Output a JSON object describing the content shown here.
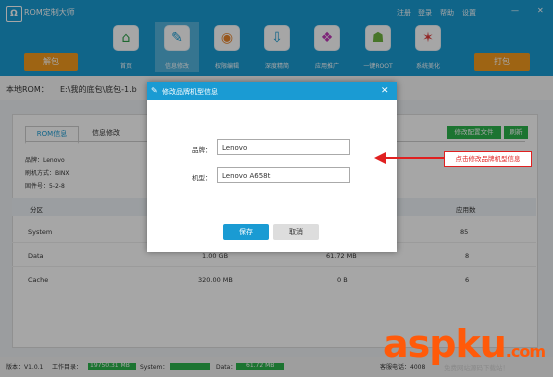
{
  "app": {
    "logo_letter": "Ω",
    "title": "ROM定制大师"
  },
  "titlebar": {
    "links": [
      "注册",
      "登录",
      "帮助",
      "设置"
    ],
    "minimize": "—",
    "close": "✕"
  },
  "toolbar": {
    "unpack_label": "解包",
    "pack_label": "打包",
    "nav": [
      {
        "label": "首页",
        "icon": "home-icon",
        "glyph": "⌂",
        "color": "#2ea04a"
      },
      {
        "label": "信息修改",
        "icon": "edit-icon",
        "glyph": "✎",
        "color": "#1a9bd3"
      },
      {
        "label": "权限编辑",
        "icon": "location-icon",
        "glyph": "◉",
        "color": "#e8842b"
      },
      {
        "label": "深度精简",
        "icon": "download-icon",
        "glyph": "⇩",
        "color": "#1a9bd3"
      },
      {
        "label": "应用推广",
        "icon": "apps-icon",
        "glyph": "❖",
        "color": "#c03ab9"
      },
      {
        "label": "一键ROOT",
        "icon": "android-icon",
        "glyph": "☗",
        "color": "#6fb43f"
      },
      {
        "label": "系统美化",
        "icon": "magic-wand-icon",
        "glyph": "✶",
        "color": "#e03a3a"
      }
    ]
  },
  "path": {
    "label": "本地ROM：",
    "value": "E:\\我的底包\\底包-1.b"
  },
  "tabs": [
    "ROM信息",
    "信息修改"
  ],
  "actions": {
    "modify_config": "修改配置文件",
    "refresh": "刷新"
  },
  "info": {
    "brand": "品牌：Lenovo",
    "flash_method": "刷机方式：BINX",
    "firmware": "固件号：5-2-8"
  },
  "table": {
    "headers": [
      "分区",
      "",
      "",
      "",
      "应用数"
    ],
    "rows": [
      [
        "System",
        "",
        "",
        "",
        "85"
      ],
      [
        "Data",
        "1.00 GB",
        "",
        "61.72 MB",
        "8"
      ],
      [
        "Cache",
        "320.00 MB",
        "",
        "0 B",
        "6"
      ]
    ]
  },
  "status": {
    "version": "版本：V1.0.1",
    "workdir_label": "工作目录：",
    "workdir_value": "19750.31 MB",
    "system_label": "System：",
    "data_label": "Data：",
    "data_value": "61.72 MB",
    "service": "客服电话：4008"
  },
  "dialog": {
    "title": "修改品牌机型信息",
    "close": "✕",
    "brand_label": "品牌：",
    "brand_value": "Lenovo",
    "model_label": "机型：",
    "model_value": "Lenovo A658t",
    "save": "保存",
    "cancel": "取消"
  },
  "annotation": {
    "callout": "点击修改品牌机型信息"
  },
  "watermark": {
    "brand": "aspku",
    "tld": ".com",
    "subtitle": "免费网站源码下载站！"
  }
}
